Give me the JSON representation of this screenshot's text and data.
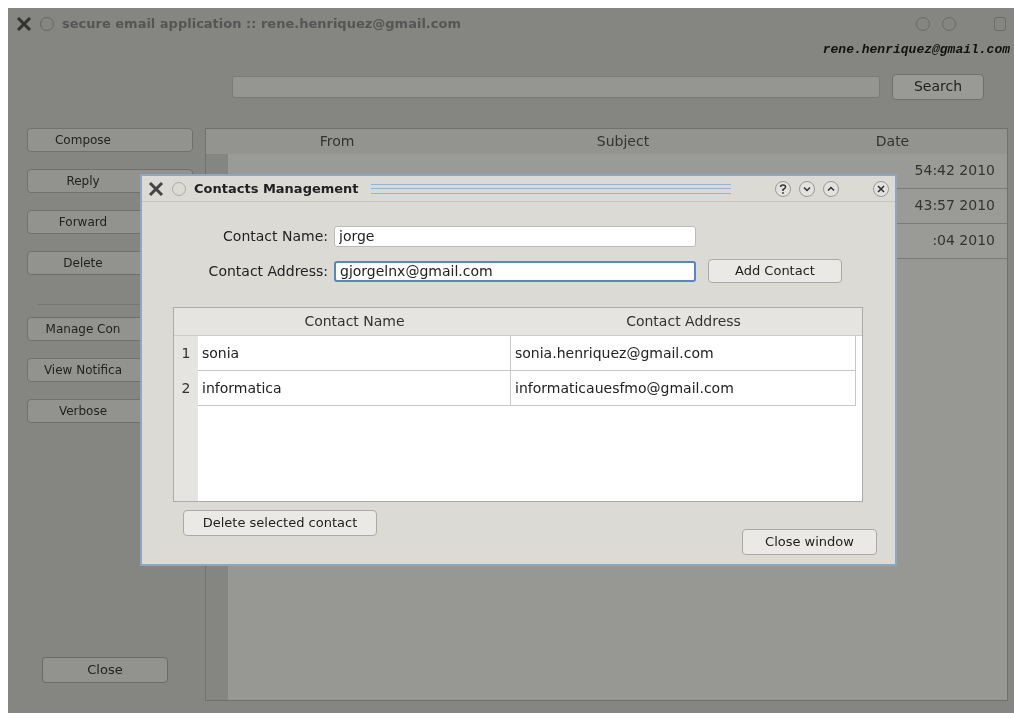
{
  "window": {
    "title": "secure email application :: rene.henriquez@gmail.com"
  },
  "account": "rene.henriquez@gmail.com",
  "search": {
    "button": "Search"
  },
  "sidebar": [
    "Compose",
    "Reply",
    "Forward",
    "Delete",
    "Manage Con",
    "View Notifica",
    "Verbose"
  ],
  "close_button": "Close",
  "mail_table": {
    "columns": [
      "From",
      "Subject",
      "Date"
    ],
    "rows": [
      {
        "date": "54:42 2010"
      },
      {
        "date": "43:57 2010"
      },
      {
        "date": ":04 2010"
      }
    ]
  },
  "dialog": {
    "title": "Contacts Management",
    "name_label": "Contact Name:",
    "name_value": "jorge",
    "address_label": "Contact Address:",
    "address_value": "gjorgelnx@gmail.com",
    "address_focused": true,
    "add_button": "Add Contact",
    "table": {
      "columns": [
        "Contact Name",
        "Contact Address"
      ],
      "rows": [
        {
          "number": "1",
          "name": "sonia",
          "address": "sonia.henriquez@gmail.com"
        },
        {
          "number": "2",
          "name": "informatica",
          "address": "informaticauesfmo@gmail.com"
        }
      ]
    },
    "delete_button": "Delete selected contact",
    "close_button": "Close window"
  }
}
